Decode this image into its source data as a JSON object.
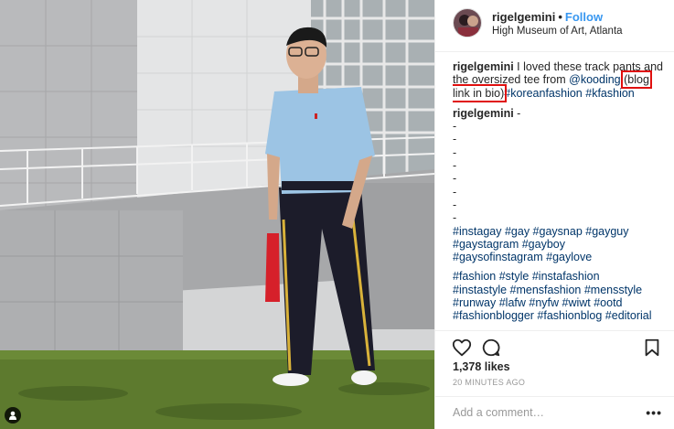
{
  "header": {
    "username": "rigelgemini",
    "separator": "•",
    "follow_label": "Follow",
    "location": "High Museum of Art, Atlanta"
  },
  "caption": {
    "username": "rigelgemini",
    "text_1": "I loved these track pants and the oversized tee from ",
    "mention": "@kooding",
    "text_2": " ",
    "boxed_text": "(blog link in bio)",
    "hashtag_1": "#koreanfashion",
    "hashtag_2": "#kfashion"
  },
  "comment": {
    "username": "rigelgemini",
    "suffix": " -",
    "dashes": [
      "-",
      "-",
      "-",
      "-",
      "-",
      "-",
      "-",
      "-"
    ],
    "tag_lines_1": [
      "#instagay #gay #gaysnap #gayguy",
      "#gaystagram #gayboy",
      "#gaysofinstagram #gaylove"
    ],
    "tag_lines_2": [
      "#fashion #style #instafashion",
      "#instastyle #mensfashion #mensstyle",
      "#runway #lafw #nyfw #wiwt #ootd",
      "#fashionblogger #fashionblog #editorial"
    ]
  },
  "actions": {
    "like_icon": "heart-icon",
    "comment_icon": "comment-icon",
    "save_icon": "bookmark-icon"
  },
  "likes": "1,378 likes",
  "timestamp": "20 MINUTES AGO",
  "add_comment": {
    "placeholder": "Add a comment…",
    "more_label": "•••"
  },
  "colors": {
    "link": "#003569",
    "follow": "#3897f0",
    "highlight_box": "#e0100f"
  }
}
